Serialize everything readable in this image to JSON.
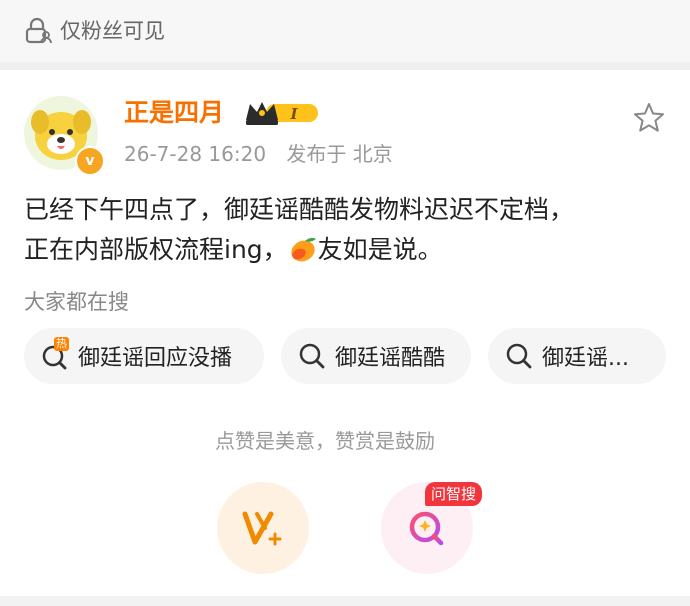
{
  "visibility": {
    "icon": "lock-person-icon",
    "text": "仅粉丝可见"
  },
  "author": {
    "name": "正是四月",
    "vip_level": "I",
    "verified_icon": "verified-v-icon",
    "timestamp": "26-7-28 16:20",
    "published_from": "发布于 北京"
  },
  "post": {
    "line1": "已经下午四点了，御廷谣酷酷发物料迟迟不定档，",
    "line2_before_emoji": "正在内部版权流程ing，",
    "emoji": "mango-emoji",
    "line2_after_emoji": "友如是说。"
  },
  "search": {
    "title": "大家都在搜",
    "hot_tag": "热",
    "chips": [
      {
        "label": "御廷谣回应没播",
        "icon": "hot-search-icon"
      },
      {
        "label": "御廷谣酷酷",
        "icon": "search-icon"
      },
      {
        "label": "御廷谣...",
        "icon": "search-icon"
      }
    ]
  },
  "reward": {
    "text": "点赞是美意，赞赏是鼓励",
    "wenzhi_tag": "问智搜"
  },
  "colors": {
    "accent": "#f77100",
    "muted": "#999999",
    "chip_bg": "#f5f5f5",
    "hot": "#ff8200",
    "wenzhi": "#f0363c"
  }
}
